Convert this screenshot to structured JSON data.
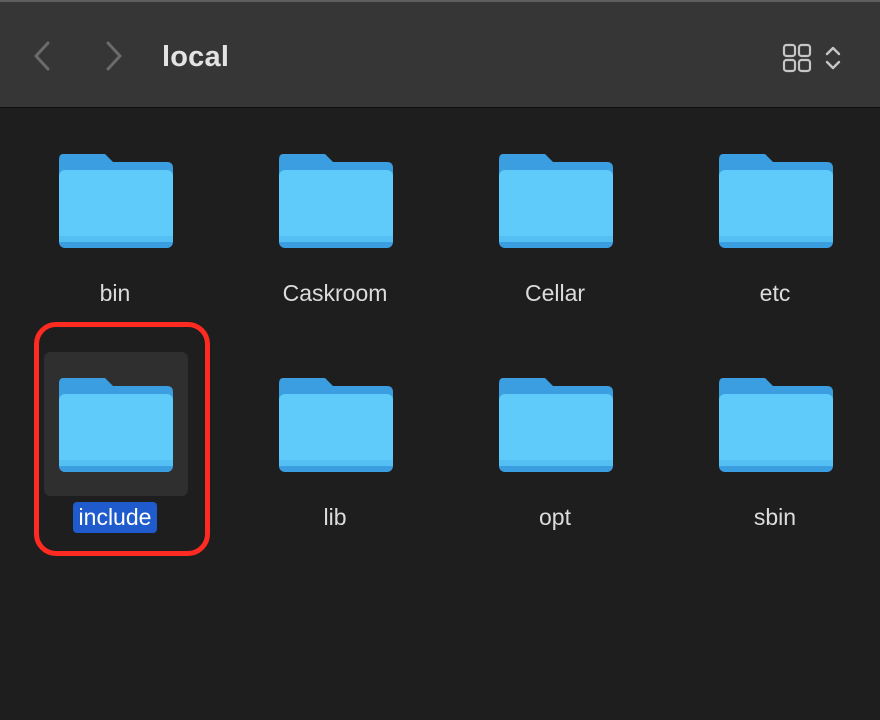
{
  "toolbar": {
    "title": "local",
    "back_icon": "chevron-left-icon",
    "forward_icon": "chevron-right-icon",
    "view_icon": "grid-view-icon",
    "view_menu_icon": "chevron-updown-icon"
  },
  "folders": [
    {
      "label": "bin",
      "icon": "folder-icon",
      "selected": false
    },
    {
      "label": "Caskroom",
      "icon": "folder-icon",
      "selected": false
    },
    {
      "label": "Cellar",
      "icon": "folder-icon",
      "selected": false
    },
    {
      "label": "etc",
      "icon": "folder-icon",
      "selected": false
    },
    {
      "label": "include",
      "icon": "folder-icon",
      "selected": true
    },
    {
      "label": "lib",
      "icon": "folder-icon",
      "selected": false
    },
    {
      "label": "opt",
      "icon": "folder-icon",
      "selected": false
    },
    {
      "label": "sbin",
      "icon": "folder-icon",
      "selected": false
    }
  ],
  "colors": {
    "folder_front": "#5ecbfa",
    "folder_back": "#3a9ee0",
    "selection": "#1f5bcc",
    "annotation": "#ff2a21"
  }
}
